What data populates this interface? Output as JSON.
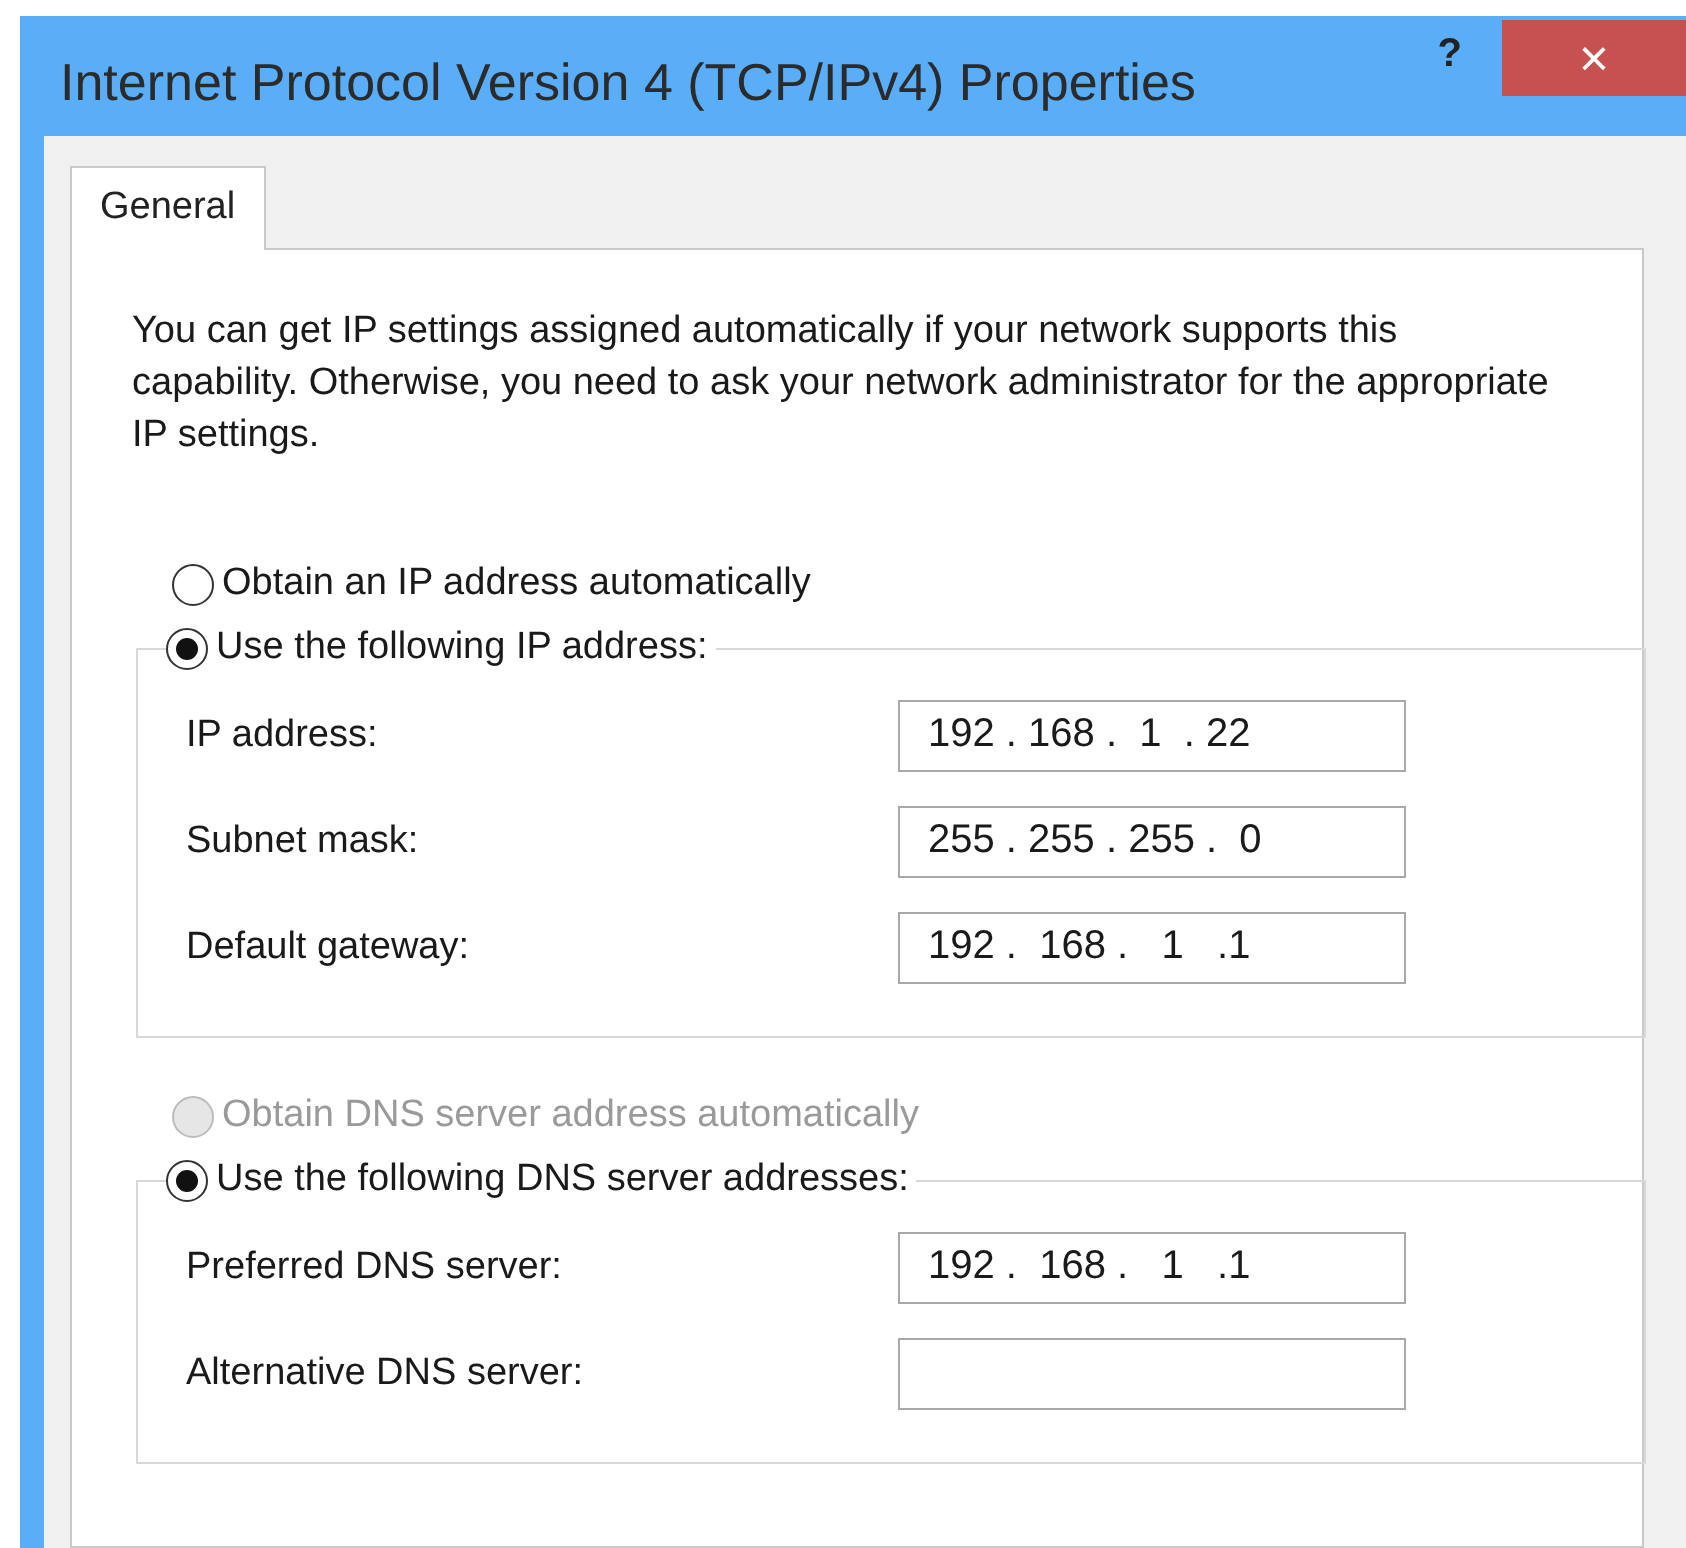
{
  "window": {
    "title": "Internet Protocol Version 4 (TCP/IPv4) Properties",
    "help": "?",
    "close": "×"
  },
  "tabs": [
    {
      "label": "General",
      "selected": true
    }
  ],
  "description": "You can get IP settings assigned automatically if your network supports this capability. Otherwise, you need to ask your network administrator for the appropriate IP settings.",
  "ip_options": [
    {
      "label": "Obtain an IP address automatically",
      "selected": false,
      "disabled": false
    },
    {
      "label": "Use the following IP address:",
      "selected": true,
      "disabled": false
    }
  ],
  "ip_fields": [
    {
      "label": "IP address:",
      "value": "192 . 168 .  1  . 22"
    },
    {
      "label": "Subnet mask:",
      "value": "255 . 255 . 255 .  0"
    },
    {
      "label": "Default gateway:",
      "value": "192 .  168 .   1   .1"
    }
  ],
  "dns_options": [
    {
      "label": "Obtain DNS server address automatically",
      "selected": false,
      "disabled": true
    },
    {
      "label": "Use the following DNS server addresses:",
      "selected": true,
      "disabled": false
    }
  ],
  "dns_fields": [
    {
      "label": "Preferred DNS server:",
      "value": "192 .  168 .   1   .1"
    },
    {
      "label": "Alternative DNS server:"
    }
  ]
}
